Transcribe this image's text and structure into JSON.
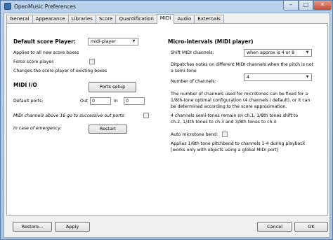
{
  "window": {
    "title": "OpenMusic Preferences",
    "min_glyph": "–",
    "max_glyph": "□",
    "close_glyph": "✕"
  },
  "tabs": [
    "General",
    "Appearance",
    "Libraries",
    "Score",
    "Quantification",
    "MIDI",
    "Audio",
    "Externals"
  ],
  "left": {
    "score_player_header": "Default score Player:",
    "score_player_value": "midi-player",
    "applies_text": "Applies to all new score boxes",
    "force_label": "Force score player:",
    "changes_text": "Changes the score player of existing boxes",
    "midi_io_header": "MIDI I/O",
    "ports_setup_label": "Ports setup",
    "default_ports_label": "Default ports:",
    "out_label": "Out",
    "out_value": "0",
    "in_label": "In",
    "in_value": "0",
    "midi_channels_label": "MIDI channels above 16 go to successive out ports:",
    "emergency_label": "In case of emergency:",
    "restart_label": "Restart"
  },
  "right": {
    "microintervals_header": "Micro-intervals (MIDI player)",
    "shift_label": "Shift MIDI channels:",
    "shift_value": "when approx is 4 or 8",
    "dispatch_line1": "Ditpatches notes on different MIDI channels when the pitch is not",
    "dispatch_line2": "a semi-tone",
    "num_channels_label": "Number of channels:",
    "num_channels_value": "4",
    "info_line1": "The number of channels used for microtones can be fixed for a",
    "info_line2": "1/8th-tone optimal configuration (4 channels / default), or it can",
    "info_line3": "be determined according to the score approximation.",
    "info_line4": "4 channels  semi-tones remain on ch.1, 1/8th tones shift to",
    "info_line5": "ch.2, 1/4th tones to ch.3 and 3/8th tones to ch.4",
    "auto_bend_label": "Auto microtone bend:",
    "applies_line1": "Applies 1/8th tone pitchbend to channels 1-4 during playback",
    "applies_line2": "[works only with objects using a global MIDI port]"
  },
  "buttons": {
    "restore": "Restore...",
    "apply": "Apply",
    "cancel": "Cancel",
    "ok": "OK"
  }
}
